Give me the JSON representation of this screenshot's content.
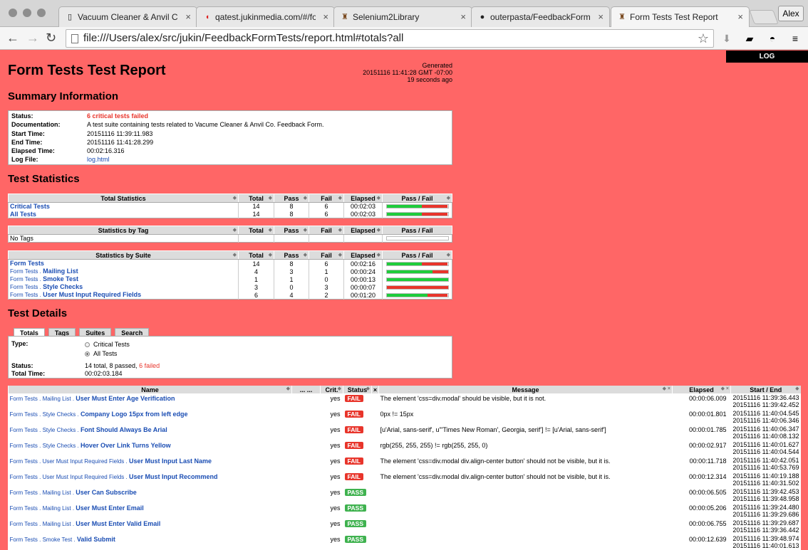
{
  "browser": {
    "tabs": [
      {
        "label": "Vacuum Cleaner & Anvil Co",
        "icon": "document-icon",
        "active": false
      },
      {
        "label": "qatest.jukinmedia.com/#/fo",
        "icon": "jukin-icon",
        "active": false
      },
      {
        "label": "Selenium2Library",
        "icon": "robot-icon",
        "active": false
      },
      {
        "label": "outerpasta/FeedbackForm",
        "icon": "github-icon",
        "active": false
      },
      {
        "label": "Form Tests Test Report",
        "icon": "robot-icon",
        "active": true
      }
    ],
    "user": "Alex",
    "url": "file:///Users/alex/src/jukin/FeedbackFormTests/report.html#totals?all"
  },
  "report": {
    "log_button": "LOG",
    "title": "Form Tests Test Report",
    "generated_label": "Generated",
    "generated_time": "20151116 11:41:28 GMT -07:00",
    "generated_ago": "19 seconds ago"
  },
  "summary": {
    "title": "Summary Information",
    "rows": [
      {
        "key": "Status:",
        "value": "6 critical tests failed"
      },
      {
        "key": "Documentation:",
        "value": "A test suite containing tests related to Vacume Cleaner & Anvil Co. Feedback Form."
      },
      {
        "key": "Start Time:",
        "value": "20151116 11:39:11.983"
      },
      {
        "key": "End Time:",
        "value": "20151116 11:41:28.299"
      },
      {
        "key": "Elapsed Time:",
        "value": "00:02:16.316"
      },
      {
        "key": "Log File:",
        "value": "log.html"
      }
    ]
  },
  "statistics": {
    "title": "Test Statistics",
    "columns": [
      "Total",
      "Pass",
      "Fail",
      "Elapsed",
      "Pass / Fail"
    ],
    "total_header": "Total Statistics",
    "total_rows": [
      {
        "name": "Critical Tests",
        "total": "14",
        "pass": "8",
        "fail": "6",
        "elapsed": "00:02:03",
        "pass_frac": 0.5714
      },
      {
        "name": "All Tests",
        "total": "14",
        "pass": "8",
        "fail": "6",
        "elapsed": "00:02:03",
        "pass_frac": 0.5714
      }
    ],
    "tag_header": "Statistics by Tag",
    "tag_rows": [
      {
        "name": "No Tags",
        "total": "",
        "pass": "",
        "fail": "",
        "elapsed": "",
        "pass_frac": null
      }
    ],
    "suite_header": "Statistics by Suite",
    "suite_rows": [
      {
        "prefix": "",
        "name": "Form Tests",
        "total": "14",
        "pass": "8",
        "fail": "6",
        "elapsed": "00:02:16",
        "pass_frac": 0.5714
      },
      {
        "prefix": "Form Tests . ",
        "name": "Mailing List",
        "total": "4",
        "pass": "3",
        "fail": "1",
        "elapsed": "00:00:24",
        "pass_frac": 0.75
      },
      {
        "prefix": "Form Tests . ",
        "name": "Smoke Test",
        "total": "1",
        "pass": "1",
        "fail": "0",
        "elapsed": "00:00:13",
        "pass_frac": 1.0
      },
      {
        "prefix": "Form Tests . ",
        "name": "Style Checks",
        "total": "3",
        "pass": "0",
        "fail": "3",
        "elapsed": "00:00:07",
        "pass_frac": 0.0
      },
      {
        "prefix": "Form Tests . ",
        "name": "User Must Input Required Fields",
        "total": "6",
        "pass": "4",
        "fail": "2",
        "elapsed": "00:01:20",
        "pass_frac": 0.6667
      }
    ]
  },
  "details": {
    "title": "Test Details",
    "tabs": [
      "Totals",
      "Tags",
      "Suites",
      "Search"
    ],
    "type_label": "Type:",
    "type_options": [
      "Critical Tests",
      "All Tests"
    ],
    "status_label": "Status:",
    "status_value": "14 total, 8 passed, ",
    "status_failed": "6 failed",
    "total_time_label": "Total Time:",
    "total_time_value": "00:02:03.184",
    "columns": {
      "name": "Name",
      "dots": "... ...",
      "crit": "Crit.",
      "status": "Status",
      "message": "Message",
      "elapsed": "Elapsed",
      "startend": "Start / End"
    },
    "tests": [
      {
        "prefix": "Form Tests . Mailing List . ",
        "name": "User Must Enter Age Verification",
        "crit": "yes",
        "status": "FAIL",
        "message": "The element 'css=div.modal' should be visible, but it is not.",
        "elapsed": "00:00:06.009",
        "start": "20151116 11:39:36.443",
        "end": "20151116 11:39:42.452"
      },
      {
        "prefix": "Form Tests . Style Checks . ",
        "name": "Company Logo 15px from left edge",
        "crit": "yes",
        "status": "FAIL",
        "message": "0px != 15px",
        "elapsed": "00:00:01.801",
        "start": "20151116 11:40:04.545",
        "end": "20151116 11:40:06.346"
      },
      {
        "prefix": "Form Tests . Style Checks . ",
        "name": "Font Should Always Be Arial",
        "crit": "yes",
        "status": "FAIL",
        "message": "[u'Arial, sans-serif', u'\"Times New Roman', Georgia, serif'] != [u'Arial, sans-serif']",
        "elapsed": "00:00:01.785",
        "start": "20151116 11:40:06.347",
        "end": "20151116 11:40:08.132"
      },
      {
        "prefix": "Form Tests . Style Checks . ",
        "name": "Hover Over Link Turns Yellow",
        "crit": "yes",
        "status": "FAIL",
        "message": "rgb(255, 255, 255) != rgb(255, 255, 0)",
        "elapsed": "00:00:02.917",
        "start": "20151116 11:40:01.627",
        "end": "20151116 11:40:04.544"
      },
      {
        "prefix": "Form Tests . User Must Input Required Fields . ",
        "name": "User Must Input Last Name",
        "crit": "yes",
        "status": "FAIL",
        "message": "The element 'css=div.modal div.align-center button' should not be visible, but it is.",
        "elapsed": "00:00:11.718",
        "start": "20151116 11:40:42.051",
        "end": "20151116 11:40:53.769"
      },
      {
        "prefix": "Form Tests . User Must Input Required Fields . ",
        "name": "User Must Input Recommend",
        "crit": "yes",
        "status": "FAIL",
        "message": "The element 'css=div.modal div.align-center button' should not be visible, but it is.",
        "elapsed": "00:00:12.314",
        "start": "20151116 11:40:19.188",
        "end": "20151116 11:40:31.502"
      },
      {
        "prefix": "Form Tests . Mailing List . ",
        "name": "User Can Subscribe",
        "crit": "yes",
        "status": "PASS",
        "message": "",
        "elapsed": "00:00:06.505",
        "start": "20151116 11:39:42.453",
        "end": "20151116 11:39:48.958"
      },
      {
        "prefix": "Form Tests . Mailing List . ",
        "name": "User Must Enter Email",
        "crit": "yes",
        "status": "PASS",
        "message": "",
        "elapsed": "00:00:05.206",
        "start": "20151116 11:39:24.480",
        "end": "20151116 11:39:29.686"
      },
      {
        "prefix": "Form Tests . Mailing List . ",
        "name": "User Must Enter Valid Email",
        "crit": "yes",
        "status": "PASS",
        "message": "",
        "elapsed": "00:00:06.755",
        "start": "20151116 11:39:29.687",
        "end": "20151116 11:39:36.442"
      },
      {
        "prefix": "Form Tests . Smoke Test . ",
        "name": "Valid Submit",
        "crit": "yes",
        "status": "PASS",
        "message": "",
        "elapsed": "00:00:12.639",
        "start": "20151116 11:39:48.974",
        "end": "20151116 11:40:01.613"
      }
    ]
  },
  "colors": {
    "page_bg": "#ff6666",
    "pass": "#1ecc3b",
    "fail": "#e8352b",
    "link": "#1a4db3"
  }
}
